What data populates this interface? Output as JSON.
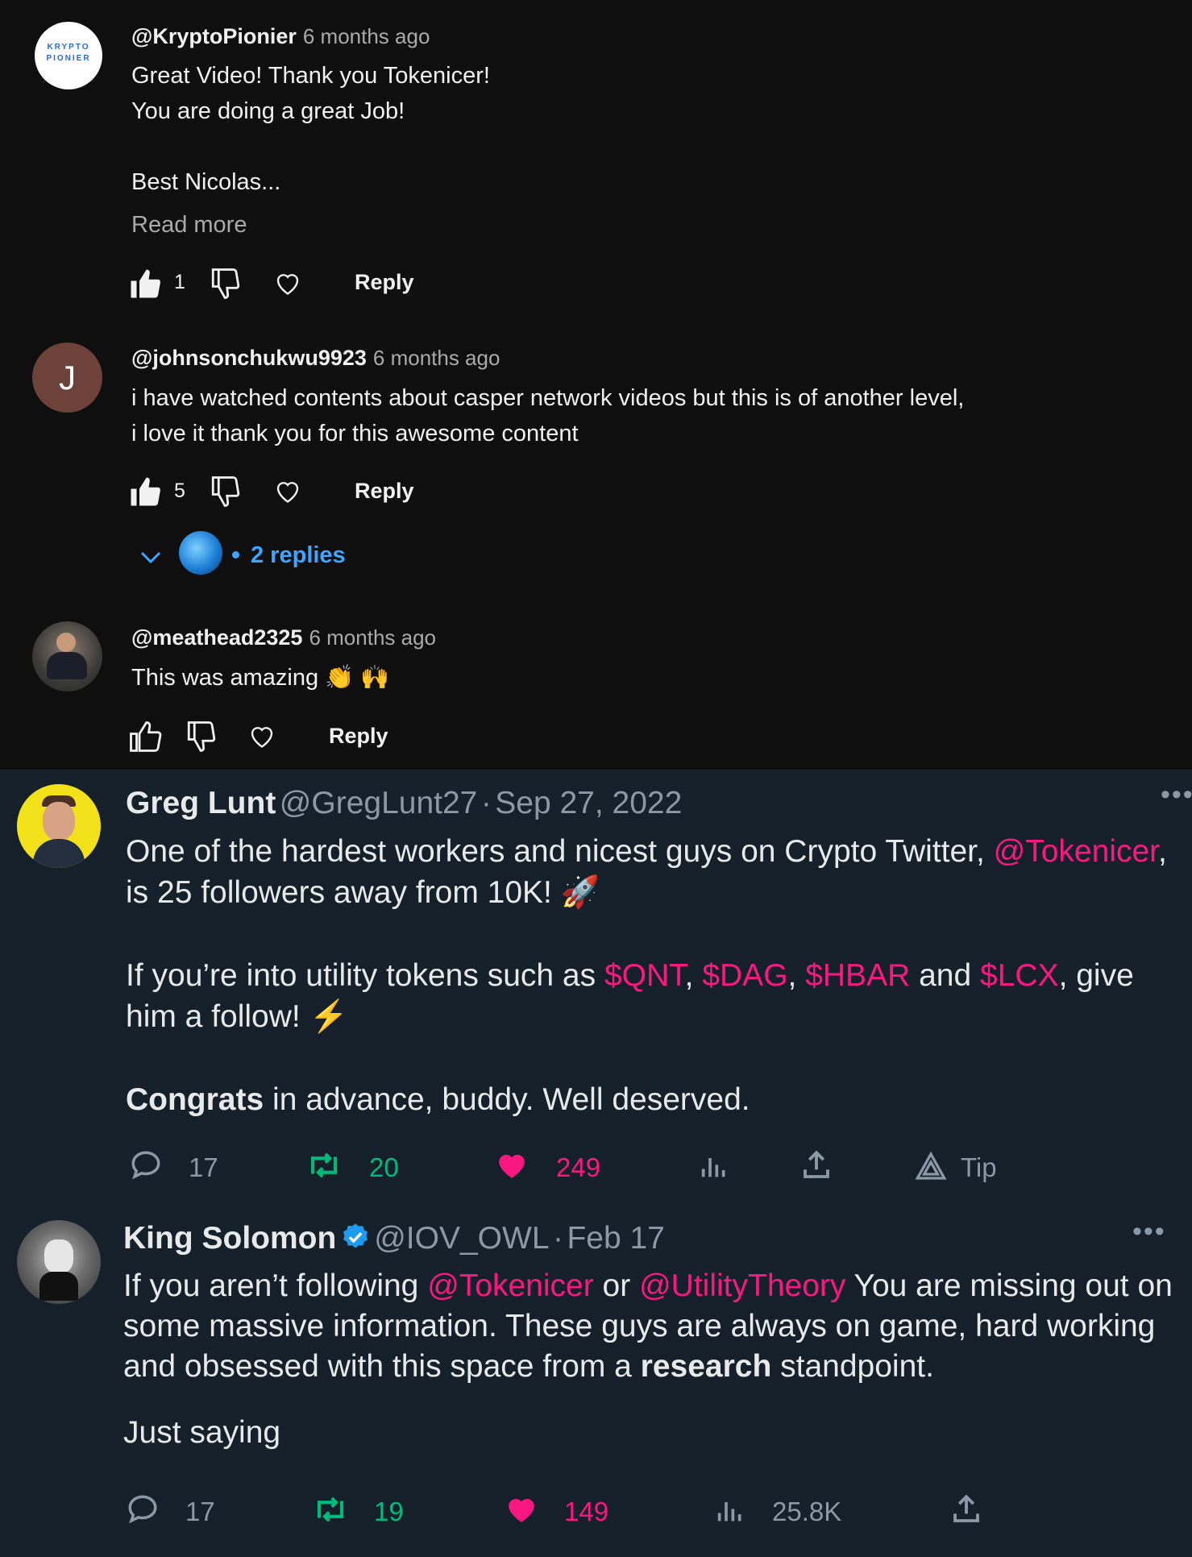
{
  "youtube": {
    "comments": [
      {
        "author": "@KryptoPionier",
        "time": "6 months ago",
        "avatar_text": [
          "KRYPTO",
          "PIONIER"
        ],
        "lines": [
          "Great Video! Thank you Tokenicer!",
          "You are doing a great Job!",
          "",
          "Best Nicolas..."
        ],
        "read_more": "Read more",
        "likes": "1",
        "reply_label": "Reply"
      },
      {
        "author": "@johnsonchukwu9923",
        "time": "6 months ago",
        "avatar_letter": "J",
        "lines": [
          "i have watched contents about casper network videos but this is of another level,",
          "i love it thank you for this awesome content"
        ],
        "likes": "5",
        "reply_label": "Reply",
        "replies_label": "2 replies"
      },
      {
        "author": "@meathead2325",
        "time": "6 months ago",
        "lines": [
          "This was amazing 👏 🙌"
        ],
        "likes": "",
        "reply_label": "Reply"
      }
    ]
  },
  "twitter": {
    "tweets": [
      {
        "name": "Greg Lunt",
        "handle": "@GregLunt27",
        "sep": "·",
        "date": "Sep 27, 2022",
        "text": {
          "l1a": "One of the hardest workers and nicest guys on Crypto Twitter, ",
          "l1b": "@Tokenicer",
          "l1c": ",",
          "l2": "is 25 followers away from 10K! 🚀",
          "l3a": "If you’re into utility tokens such as ",
          "l3b": "$QNT",
          "l3c": ", ",
          "l3d": "$DAG",
          "l3e": ", ",
          "l3f": "$HBAR",
          "l3g": " and ",
          "l3h": "$LCX",
          "l3i": ", give",
          "l4": "him a follow! ⚡",
          "l5a": "Congrats",
          "l5b": " in advance, buddy. Well deserved."
        },
        "replies": "17",
        "retweets": "20",
        "likes": "249",
        "tip_label": "Tip"
      },
      {
        "name": "King Solomon",
        "handle": "@IOV_OWL",
        "sep": "·",
        "date": "Feb 17",
        "text": {
          "l1a": "If you aren’t following ",
          "l1b": "@Tokenicer",
          "l1c": " or ",
          "l1d": "@UtilityTheory",
          "l1e": " You are missing out on",
          "l2": "some massive information. These guys are always on game, hard working",
          "l3a": "and obsessed with this space from a ",
          "l3b": "research",
          "l3c": " standpoint.",
          "l4": "Just saying"
        },
        "replies": "17",
        "retweets": "19",
        "likes": "149",
        "views": "25.8K"
      }
    ]
  },
  "colors": {
    "yt_bg": "#0f0f0f",
    "tw_bg": "#15202b",
    "link_blue": "#3ea6ff",
    "tw_pink": "#f91880",
    "tw_green": "#00ba7c",
    "tw_grey": "#8b98a5",
    "verified_blue": "#1d9bf0"
  }
}
